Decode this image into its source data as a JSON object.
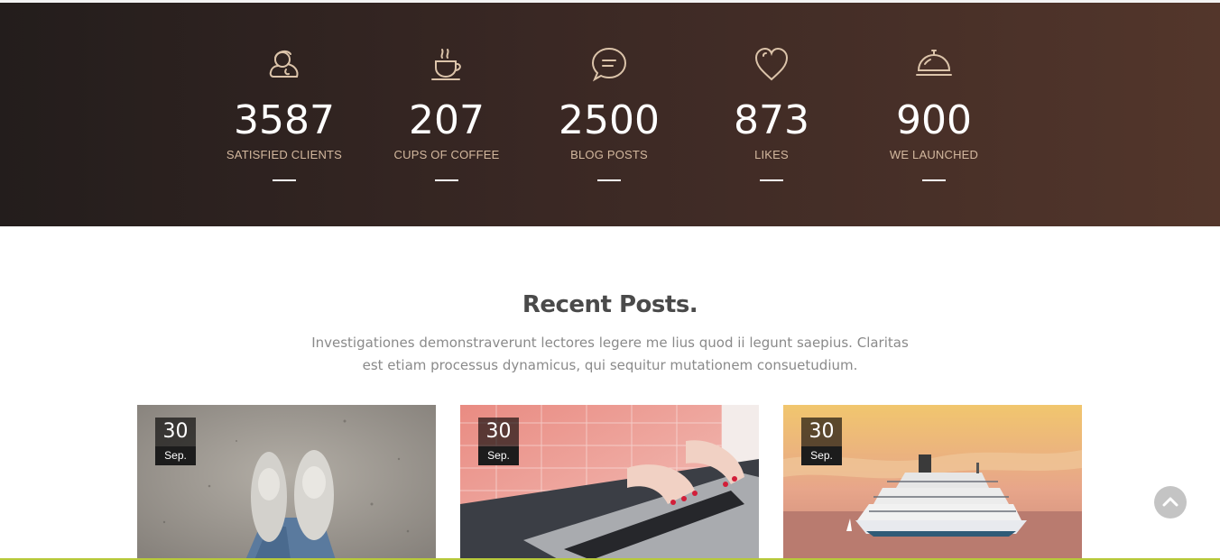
{
  "stats": [
    {
      "icon": "user-icon",
      "value": "3587",
      "label": "SATISFIED CLIENTS"
    },
    {
      "icon": "coffee-cup-icon",
      "value": "207",
      "label": "CUPS OF COFFEE"
    },
    {
      "icon": "chat-bubble-icon",
      "value": "2500",
      "label": "BLOG POSTS"
    },
    {
      "icon": "heart-icon",
      "value": "873",
      "label": "LIKES"
    },
    {
      "icon": "service-bell-icon",
      "value": "900",
      "label": "WE LAUNCHED"
    }
  ],
  "recent_posts": {
    "title": "Recent Posts.",
    "description": "Investigationes demonstraverunt lectores legere me lius quod ii legunt saepius. Claritas est etiam processus dynamicus, qui sequitur mutationem consuetudium.",
    "posts": [
      {
        "day": "30",
        "month": "Sep.",
        "image": "feet-on-sand-photo"
      },
      {
        "day": "30",
        "month": "Sep.",
        "image": "typing-on-laptop-photo"
      },
      {
        "day": "30",
        "month": "Sep.",
        "image": "cruise-ship-sunset-photo"
      }
    ]
  },
  "colors": {
    "band_start": "#231d1c",
    "band_end": "#53362b",
    "accent_label": "#d3b89e",
    "icon_stroke": "#dcc4aa"
  },
  "scroll_top": {
    "icon": "chevron-up-icon"
  }
}
